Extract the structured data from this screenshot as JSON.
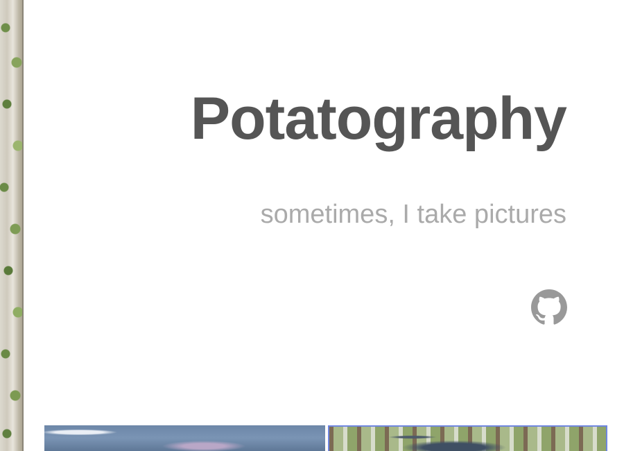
{
  "site": {
    "title": "Potatography",
    "tagline": "sometimes, I take pictures"
  },
  "social": {
    "github_icon": "github-icon",
    "icon_color": "#999999"
  },
  "colors": {
    "title": "#555555",
    "tagline": "#aaaaaa",
    "selected_thumb_border": "#6f86e0"
  }
}
